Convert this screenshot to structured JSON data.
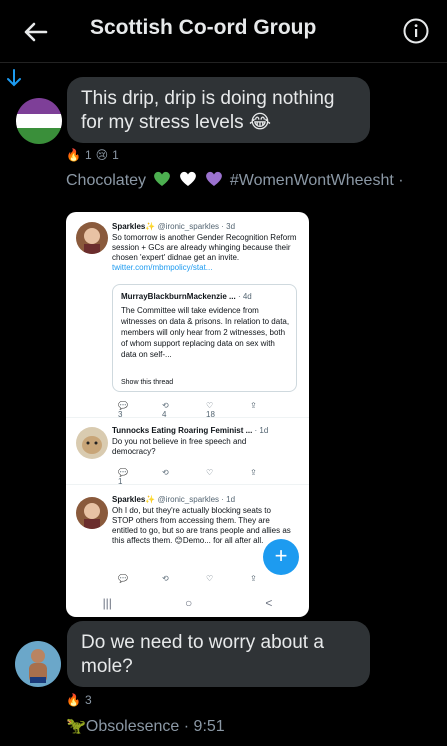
{
  "header": {
    "title": "Scottish Co-ord Group",
    "back_icon": "arrow-left-icon",
    "info_icon": "info-icon"
  },
  "messages": [
    {
      "text": "This drip, drip is doing nothing for my stress levels 😂",
      "reactions": [
        {
          "emoji": "🔥",
          "count": "1"
        },
        {
          "emoji": "😢",
          "count": "1"
        }
      ],
      "sender": "Chocolatey",
      "sender_suffix": "#WomenWontWheesht ·",
      "heart_colors": [
        "#4caf50",
        "#ffffff",
        "#9b72cf"
      ]
    },
    {
      "text": "Do we need to worry about a mole?",
      "reactions": [
        {
          "emoji": "🔥",
          "count": "3"
        }
      ],
      "sender": "🦖Obsolesence",
      "time": "· 9:51"
    }
  ],
  "attachment": {
    "tweet1": {
      "name": "Sparkles✨",
      "handle": "@ironic_sparkles · 3d",
      "text": "So tomorrow is another Gender Recognition Reform session + GCs are already whinging because their chosen 'expert' didnae get an invite.",
      "link": "twitter.com/mbmpolicy/stat...",
      "quote_name": "MurrayBlackburnMackenzie ...",
      "quote_time": "· 4d",
      "quote_text": "The Committee will take evidence from witnesses on data & prisons. In relation to data, members will only hear from 2 witnesses, both of whom support replacing data on sex with data on self-...",
      "quote_more": "Show this thread",
      "stats": [
        "3",
        "4",
        "18"
      ]
    },
    "tweet2": {
      "name": "Tunnocks Eating Roaring Feminist ...",
      "time": "· 1d",
      "text": "Do you not believe in free speech and democracy?",
      "stats": [
        "1"
      ]
    },
    "tweet3": {
      "name": "Sparkles✨",
      "handle": "@ironic_sparkles · 1d",
      "text": "Oh I do, but they're actually blocking seats to STOP others from accessing them. They are entitled to go, but so are trans people and allies as this affects them. 😊Demo... for all after all."
    },
    "nav": [
      "|||",
      "○",
      "<"
    ],
    "fab": "+"
  }
}
